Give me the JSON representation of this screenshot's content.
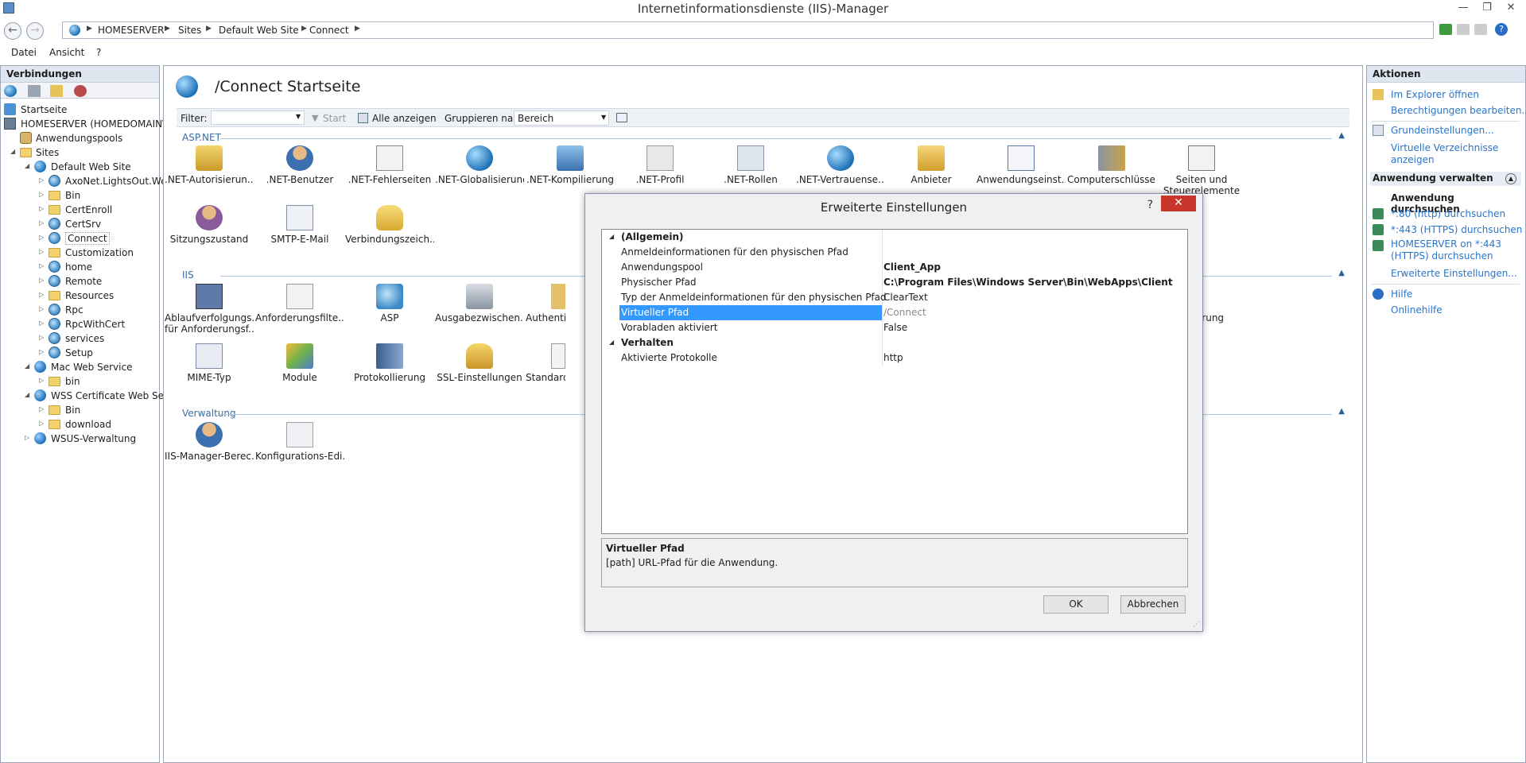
{
  "window": {
    "title": "Internetinformationsdienste (IIS)-Manager"
  },
  "address": {
    "crumbs": [
      "HOMESERVER",
      "Sites",
      "Default Web Site",
      "Connect"
    ]
  },
  "menu": {
    "items": [
      "Datei",
      "Ansicht",
      "?"
    ]
  },
  "connections": {
    "header": "Verbindungen",
    "tree": [
      {
        "label": "Startseite"
      },
      {
        "label": "HOMESERVER (HOMEDOMAIN\\a"
      },
      {
        "label": "Anwendungspools"
      },
      {
        "label": "Sites"
      },
      {
        "label": "Default Web Site"
      },
      {
        "label": "AxoNet.LightsOut.Web"
      },
      {
        "label": "Bin"
      },
      {
        "label": "CertEnroll"
      },
      {
        "label": "CertSrv"
      },
      {
        "label": "Connect"
      },
      {
        "label": "Customization"
      },
      {
        "label": "home"
      },
      {
        "label": "Remote"
      },
      {
        "label": "Resources"
      },
      {
        "label": "Rpc"
      },
      {
        "label": "RpcWithCert"
      },
      {
        "label": "services"
      },
      {
        "label": "Setup"
      },
      {
        "label": "Mac Web Service"
      },
      {
        "label": "bin"
      },
      {
        "label": "WSS Certificate Web Servi"
      },
      {
        "label": "Bin"
      },
      {
        "label": "download"
      },
      {
        "label": "WSUS-Verwaltung"
      }
    ]
  },
  "main": {
    "title": "/Connect Startseite",
    "filter": {
      "label": "Filter:",
      "start": "Start",
      "show_all": "Alle anzeigen",
      "group_label": "Gruppieren nach:",
      "group_value": "Bereich"
    },
    "sections": {
      "aspnet": "ASP.NET",
      "iis": "IIS",
      "mgmt": "Verwaltung"
    },
    "aspnet_features": [
      {
        "l1": ".NET-Autorisierun...",
        "l2": ""
      },
      {
        "l1": ".NET-Benutzer",
        "l2": ""
      },
      {
        "l1": ".NET-Fehlerseiten",
        "l2": ""
      },
      {
        "l1": ".NET-Globalisierung",
        "l2": ""
      },
      {
        "l1": ".NET-Kompilierung",
        "l2": ""
      },
      {
        "l1": ".NET-Profil",
        "l2": ""
      },
      {
        "l1": ".NET-Rollen",
        "l2": ""
      },
      {
        "l1": ".NET-Vertrauense...",
        "l2": ""
      },
      {
        "l1": "Anbieter",
        "l2": ""
      },
      {
        "l1": "Anwendungseinst...",
        "l2": ""
      },
      {
        "l1": "Computerschlüssel",
        "l2": ""
      },
      {
        "l1": "Seiten und",
        "l2": "Steuerelemente"
      },
      {
        "l1": "Sitzungszustand",
        "l2": ""
      },
      {
        "l1": "SMTP-E-Mail",
        "l2": ""
      },
      {
        "l1": "Verbindungszeich...",
        "l2": ""
      }
    ],
    "iis_features": [
      {
        "l1": "Ablaufverfolgungs...",
        "l2": "für Anforderungsf..."
      },
      {
        "l1": "Anforderungsfilte...",
        "l2": ""
      },
      {
        "l1": "ASP",
        "l2": ""
      },
      {
        "l1": "Ausgabezwischen...",
        "l2": ""
      },
      {
        "l1": "Authenti",
        "l2": ""
      },
      {
        "l1": "primierung",
        "l2": ""
      },
      {
        "l1": "MIME-Typ",
        "l2": ""
      },
      {
        "l1": "Module",
        "l2": ""
      },
      {
        "l1": "Protokollierung",
        "l2": ""
      },
      {
        "l1": "SSL-Einstellungen",
        "l2": ""
      },
      {
        "l1": "Standardd",
        "l2": ""
      }
    ],
    "mgmt_features": [
      {
        "l1": "IIS-Manager-Berec...",
        "l2": ""
      },
      {
        "l1": "Konfigurations-Edi...",
        "l2": ""
      }
    ]
  },
  "actions": {
    "header": "Aktionen",
    "explore": "Im Explorer öffnen",
    "perms": "Berechtigungen bearbeiten...",
    "basic": "Grundeinstellungen...",
    "vdirs_1": "Virtuelle Verzeichnisse",
    "vdirs_2": "anzeigen",
    "manage_app": "Anwendung verwalten",
    "browse_app": "Anwendung durchsuchen",
    "browse_80": "*:80 (http) durchsuchen",
    "browse_443": "*:443 (HTTPS) durchsuchen",
    "browse_host_1": "HOMESERVER on *:443",
    "browse_host_2": "(HTTPS) durchsuchen",
    "advanced": "Erweiterte Einstellungen...",
    "help": "Hilfe",
    "online_help": "Onlinehilfe"
  },
  "dialog": {
    "title": "Erweiterte Einstellungen",
    "help_glyph": "?",
    "cat_general": "(Allgemein)",
    "cat_behavior": "Verhalten",
    "rows_general": [
      {
        "key": "Anmeldeinformationen für den physischen Pfad",
        "value": ""
      },
      {
        "key": "Anwendungspool",
        "value": "Client_App"
      },
      {
        "key": "Physischer Pfad",
        "value": "C:\\Program Files\\Windows Server\\Bin\\WebApps\\Client"
      },
      {
        "key": "Typ der Anmeldeinformationen für den physischen Pfad",
        "value": "ClearText"
      },
      {
        "key": "Virtueller Pfad",
        "value": "/Connect"
      },
      {
        "key": "Vorabladen aktiviert",
        "value": "False"
      }
    ],
    "rows_behavior": [
      {
        "key": "Aktivierte Protokolle",
        "value": "http"
      }
    ],
    "desc_title": "Virtueller Pfad",
    "desc_text": "[path] URL-Pfad für die Anwendung.",
    "ok": "OK",
    "cancel": "Abbrechen"
  },
  "colors": {
    "accent": "#3399ff",
    "link": "#2b75c9",
    "close": "#c7352b"
  }
}
